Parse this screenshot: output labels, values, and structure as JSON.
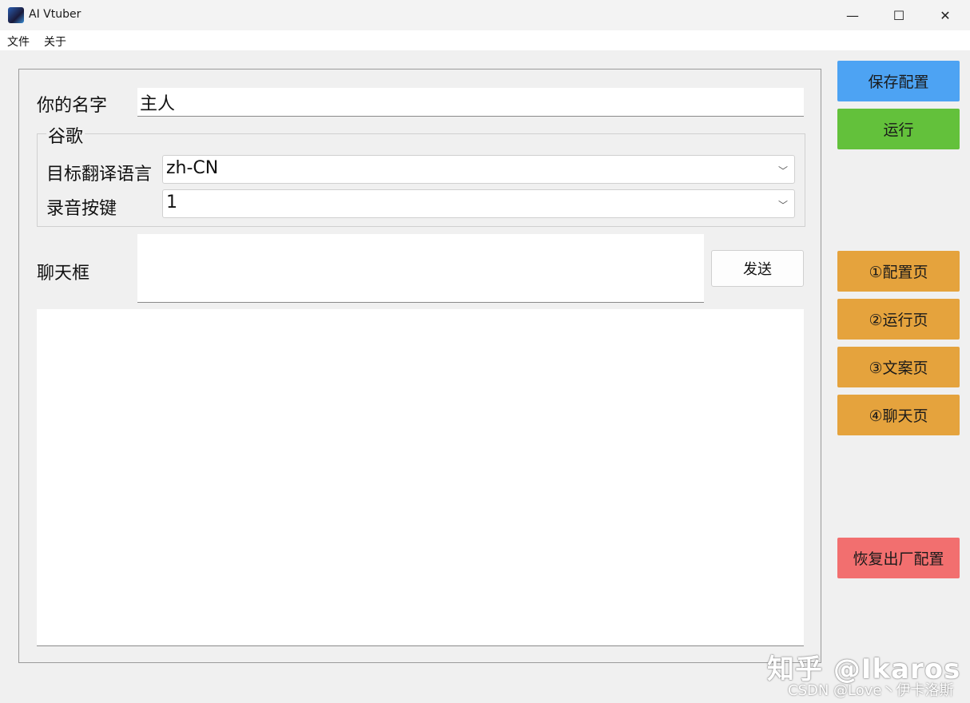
{
  "window": {
    "title": "AI Vtuber",
    "minimize": "—",
    "maximize": "☐",
    "close": "✕"
  },
  "menu": [
    "文件",
    "关于"
  ],
  "form": {
    "name_label": "你的名字",
    "name_value": "主人",
    "group_title": "谷歌",
    "target_lang_label": "目标翻译语言",
    "target_lang_value": "zh-CN",
    "record_key_label": "录音按键",
    "record_key_value": "1",
    "chat_label": "聊天框",
    "chat_value": "",
    "send_label": "发送",
    "log_value": ""
  },
  "sidebar": {
    "save": "保存配置",
    "run": "运行",
    "pages": [
      "①配置页",
      "②运行页",
      "③文案页",
      "④聊天页"
    ],
    "reset": "恢复出厂配置"
  },
  "watermark": {
    "line1": "知乎 @Ikaros",
    "line2": "CSDN @Love丶伊卡洛斯"
  },
  "colors": {
    "save": "#4da3f3",
    "run": "#63c13b",
    "page": "#e5a33d",
    "reset": "#f26f6f"
  }
}
